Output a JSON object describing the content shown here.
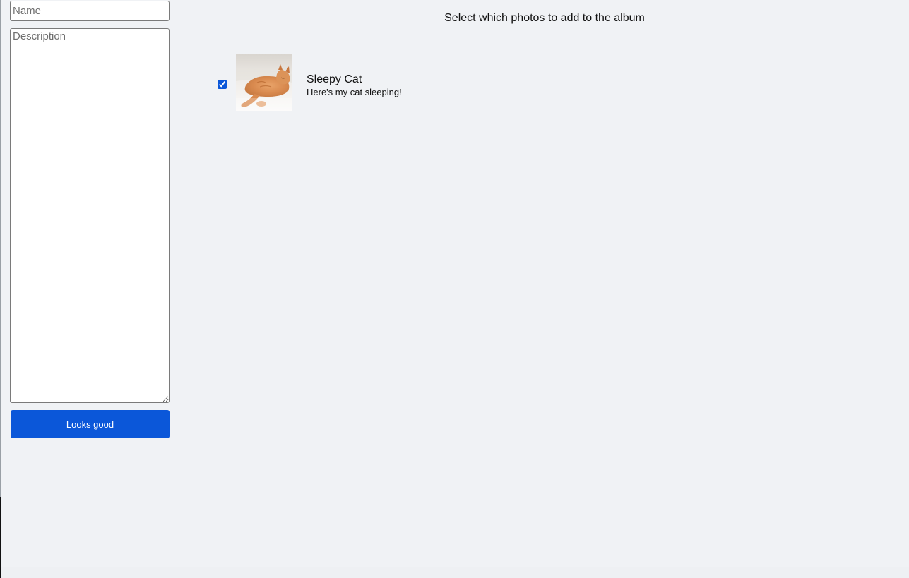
{
  "form": {
    "name_placeholder": "Name",
    "name_value": "",
    "description_placeholder": "Description",
    "description_value": "",
    "submit_label": "Looks good"
  },
  "main": {
    "heading": "Select which photos to add to the album",
    "photos": [
      {
        "title": "Sleepy Cat",
        "description": "Here's my cat sleeping!",
        "selected": true,
        "thumbnail": "sleeping-cat-photo"
      }
    ]
  },
  "colors": {
    "page_background": "#f0f2f5",
    "accent": "#0b57d9",
    "button_text": "#ffffff"
  }
}
